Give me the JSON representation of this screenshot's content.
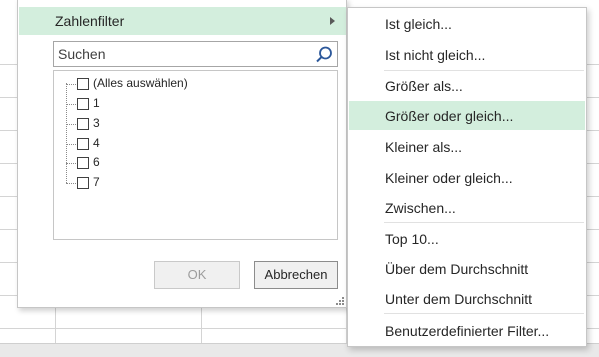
{
  "filter_panel": {
    "number_filters_label": "Zahlenfilter",
    "search_placeholder": "Suchen",
    "list_items": [
      {
        "label": "(Alles auswählen)",
        "checked": false
      },
      {
        "label": "1",
        "checked": false
      },
      {
        "label": "3",
        "checked": false
      },
      {
        "label": "4",
        "checked": false
      },
      {
        "label": "6",
        "checked": false
      },
      {
        "label": "7",
        "checked": false
      }
    ],
    "ok_label": "OK",
    "cancel_label": "Abbrechen"
  },
  "submenu": {
    "items": [
      {
        "label": "Ist gleich..."
      },
      {
        "label": "Ist nicht gleich..."
      },
      {
        "label": "Größer als..."
      },
      {
        "label": "Größer oder gleich..."
      },
      {
        "label": "Kleiner als..."
      },
      {
        "label": "Kleiner oder gleich..."
      },
      {
        "label": "Zwischen..."
      },
      {
        "label": "Top 10..."
      },
      {
        "label": "Über dem Durchschnitt"
      },
      {
        "label": "Unter dem Durchschnitt"
      },
      {
        "label": "Benutzerdefinierter Filter..."
      }
    ],
    "highlighted_item": "Größer oder gleich..."
  },
  "colors": {
    "highlight": "#d3eedd",
    "border": "#c6c6c6",
    "search_icon": "#2b579a"
  }
}
